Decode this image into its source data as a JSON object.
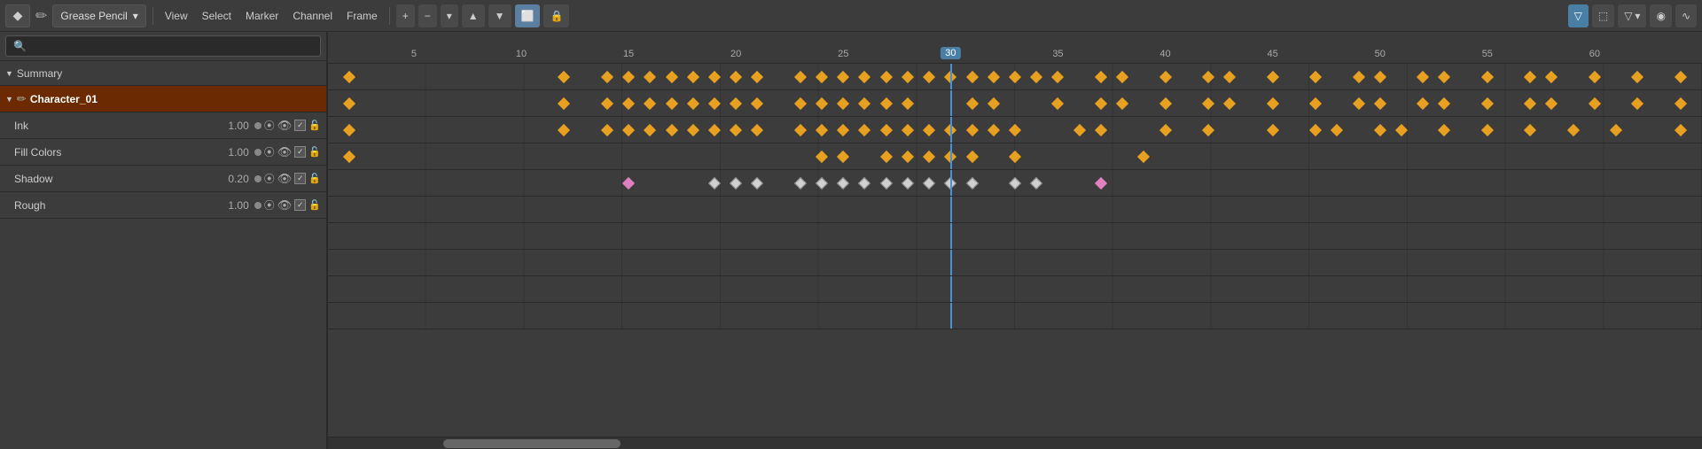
{
  "toolbar": {
    "mode_icon": "◆",
    "grease_pencil_label": "Grease Pencil",
    "dropdown_arrow": "▾",
    "view_label": "View",
    "select_label": "Select",
    "marker_label": "Marker",
    "channel_label": "Channel",
    "frame_label": "Frame",
    "add_btn": "+",
    "remove_btn": "−",
    "dropdown2_btn": "▾",
    "up_btn": "▲",
    "down_btn": "▼",
    "screen_btn": "⬜",
    "lock_btn": "🔒",
    "right_filter_btn": "▼",
    "right_frame_btn": "⬜",
    "right_funnel_btn": "▽",
    "right_circle_btn": "◉",
    "right_wave_btn": "∿"
  },
  "left_panel": {
    "search_placeholder": "🔍",
    "summary_label": "Summary",
    "character_label": "Character_01",
    "channels": [
      {
        "name": "Ink",
        "value": "1.00"
      },
      {
        "name": "Fill Colors",
        "value": "1.00"
      },
      {
        "name": "Shadow",
        "value": "0.20"
      },
      {
        "name": "Rough",
        "value": "1.00"
      }
    ]
  },
  "ruler": {
    "ticks": [
      5,
      10,
      15,
      20,
      25,
      30,
      35,
      40,
      45,
      50,
      55,
      60
    ],
    "current_frame": 30
  },
  "accent_color": "#4a90d9",
  "orange_kf": "#e8a020",
  "white_kf": "#d0d0d0",
  "pink_kf": "#e080c0"
}
